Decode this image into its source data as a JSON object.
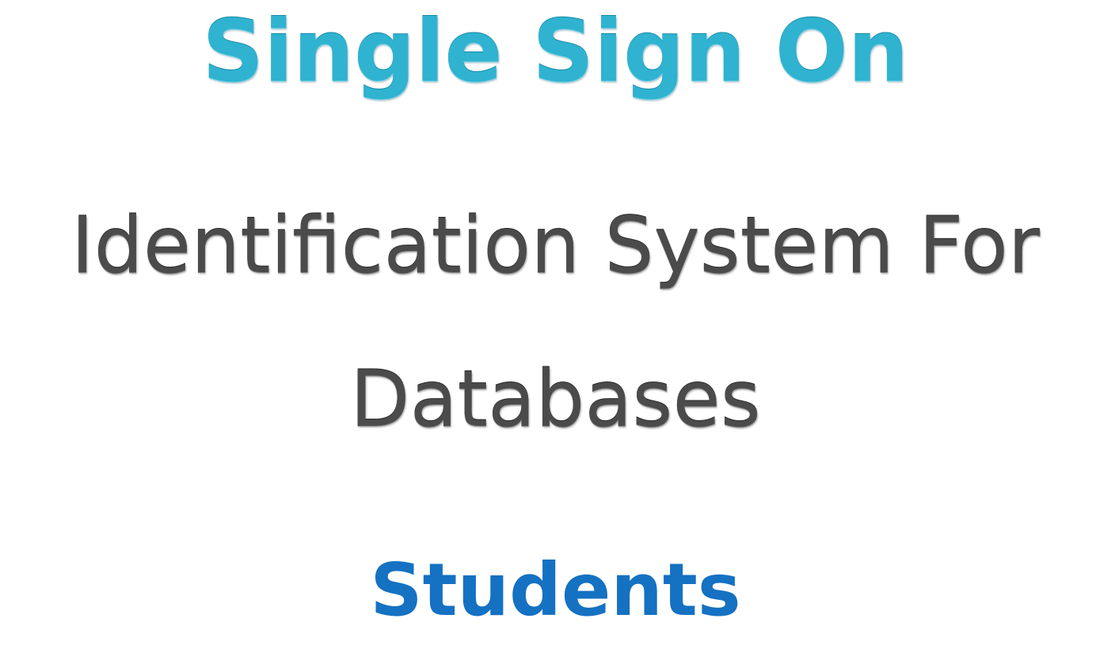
{
  "title": "Single Sign On",
  "subtitle_line1": "Identification System For",
  "subtitle_line2": "Databases",
  "footer": "Students",
  "colors": {
    "title": "#2fb3d0",
    "subtitle": "#4b4b4b",
    "footer": "#1571c2"
  }
}
